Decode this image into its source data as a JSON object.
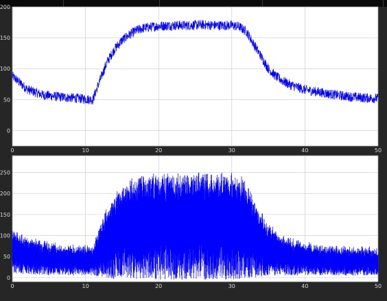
{
  "chart_data": [
    {
      "type": "line",
      "title": "",
      "xlabel": "",
      "ylabel": "",
      "xlim": [
        0,
        50
      ],
      "ylim": [
        -25,
        200
      ],
      "x_ticks": [
        "0",
        "10",
        "20",
        "30",
        "40",
        "50"
      ],
      "y_ticks": [
        "0",
        "50",
        "100",
        "150",
        "200"
      ],
      "grid": true,
      "series": [
        {
          "color": "#0000ff",
          "x": [
            0,
            2,
            4,
            6,
            8,
            10,
            11,
            12,
            13,
            14,
            15,
            16,
            17,
            18,
            20,
            22,
            24,
            26,
            28,
            30,
            31,
            32,
            33,
            34,
            35,
            36,
            37,
            38,
            39,
            40,
            42,
            44,
            46,
            48,
            50
          ],
          "values": [
            88,
            67,
            58,
            55,
            53,
            51,
            50,
            82,
            112,
            132,
            146,
            155,
            162,
            166,
            169,
            170,
            170,
            171,
            170,
            170,
            168,
            160,
            140,
            120,
            100,
            88,
            80,
            74,
            70,
            66,
            62,
            58,
            55,
            53,
            52
          ]
        }
      ]
    },
    {
      "type": "line",
      "title": "",
      "xlabel": "",
      "ylabel": "",
      "xlim": [
        0,
        50
      ],
      "ylim": [
        -10,
        290
      ],
      "x_ticks": [
        "0",
        "10",
        "20",
        "30",
        "40",
        "50"
      ],
      "y_ticks": [
        "0",
        "50",
        "100",
        "150",
        "200",
        "250"
      ],
      "grid": true,
      "series": [
        {
          "color": "#0000ff",
          "x": [
            0,
            2,
            4,
            6,
            8,
            10,
            11,
            12,
            13,
            14,
            15,
            16,
            17,
            18,
            20,
            22,
            24,
            26,
            28,
            30,
            31,
            32,
            33,
            34,
            35,
            36,
            37,
            38,
            39,
            40,
            42,
            44,
            46,
            48,
            50
          ],
          "envelope": [
            110,
            92,
            82,
            76,
            73,
            71,
            70,
            120,
            165,
            195,
            215,
            228,
            235,
            240,
            242,
            243,
            244,
            244,
            243,
            242,
            240,
            225,
            185,
            150,
            125,
            108,
            96,
            88,
            82,
            78,
            73,
            70,
            68,
            67,
            66
          ],
          "floor": [
            10,
            8,
            6,
            5,
            5,
            5,
            5,
            2,
            -2,
            -4,
            -5,
            -5,
            -5,
            -5,
            -5,
            -5,
            -5,
            -5,
            -5,
            -5,
            -5,
            -3,
            0,
            2,
            4,
            5,
            5,
            5,
            5,
            5,
            5,
            5,
            5,
            5,
            5
          ]
        }
      ]
    }
  ]
}
